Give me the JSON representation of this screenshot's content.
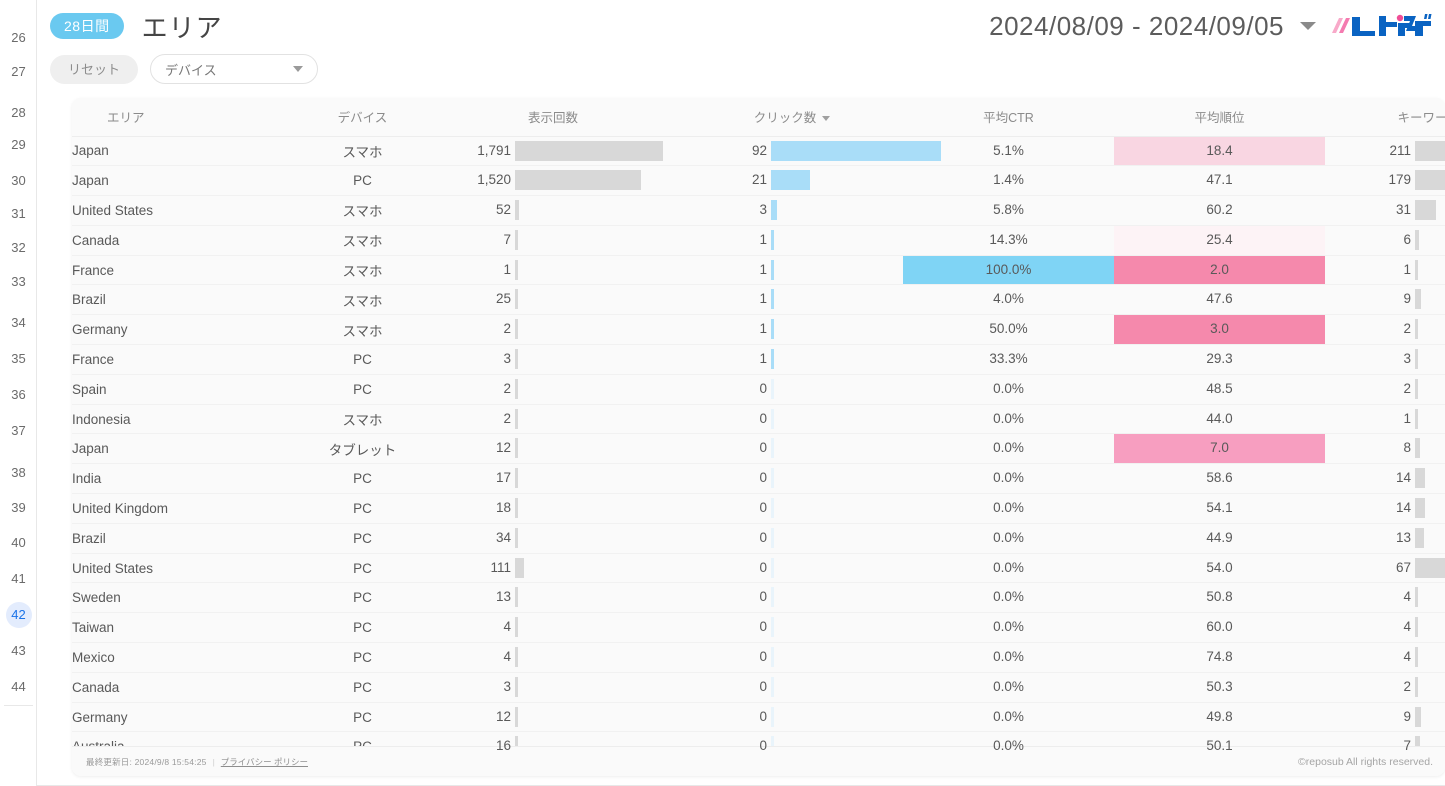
{
  "gutter": {
    "numbers": [
      26,
      27,
      28,
      29,
      30,
      31,
      32,
      33,
      34,
      35,
      36,
      37,
      38,
      39,
      40,
      41,
      42,
      43,
      44
    ],
    "active": 42
  },
  "header": {
    "period_badge": "28日間",
    "title": "エリア",
    "date_range": "2024/08/09 - 2024/09/05",
    "caret_icon": "chevron-down-icon",
    "logo_text": "レポサブ",
    "logo_colors": {
      "blue": "#0a63c2",
      "pink": "#f47bb0"
    }
  },
  "filters": {
    "reset_label": "リセット",
    "device_select": {
      "value": "デバイス",
      "caret_icon": "chevron-down-icon"
    }
  },
  "table": {
    "columns": [
      {
        "key": "area",
        "label": "エリア",
        "align": "left",
        "sorted": false
      },
      {
        "key": "device",
        "label": "デバイス",
        "align": "center",
        "sorted": false
      },
      {
        "key": "imp",
        "label": "表示回数",
        "align": "center",
        "sorted": false
      },
      {
        "key": "clicks",
        "label": "クリック数",
        "align": "center",
        "sorted": true
      },
      {
        "key": "ctr",
        "label": "平均CTR",
        "align": "center",
        "sorted": false
      },
      {
        "key": "pos",
        "label": "平均順位",
        "align": "center",
        "sorted": false
      },
      {
        "key": "kw",
        "label": "キーワード数",
        "align": "center",
        "sorted": false
      }
    ],
    "sort_caret_icon": "caret-down-icon",
    "rows": [
      {
        "area": "Japan",
        "device": "スマホ",
        "imp": "1,791",
        "imp_v": 1791,
        "clicks": "92",
        "clicks_v": 92,
        "ctr": "5.1%",
        "ctr_v": 5.1,
        "pos": "18.4",
        "pos_v": 18.4,
        "kw": "211",
        "kw_v": 211
      },
      {
        "area": "Japan",
        "device": "PC",
        "imp": "1,520",
        "imp_v": 1520,
        "clicks": "21",
        "clicks_v": 21,
        "ctr": "1.4%",
        "ctr_v": 1.4,
        "pos": "47.1",
        "pos_v": 47.1,
        "kw": "179",
        "kw_v": 179
      },
      {
        "area": "United States",
        "device": "スマホ",
        "imp": "52",
        "imp_v": 52,
        "clicks": "3",
        "clicks_v": 3,
        "ctr": "5.8%",
        "ctr_v": 5.8,
        "pos": "60.2",
        "pos_v": 60.2,
        "kw": "31",
        "kw_v": 31
      },
      {
        "area": "Canada",
        "device": "スマホ",
        "imp": "7",
        "imp_v": 7,
        "clicks": "1",
        "clicks_v": 1,
        "ctr": "14.3%",
        "ctr_v": 14.3,
        "pos": "25.4",
        "pos_v": 25.4,
        "kw": "6",
        "kw_v": 6
      },
      {
        "area": "France",
        "device": "スマホ",
        "imp": "1",
        "imp_v": 1,
        "clicks": "1",
        "clicks_v": 1,
        "ctr": "100.0%",
        "ctr_v": 100.0,
        "pos": "2.0",
        "pos_v": 2.0,
        "kw": "1",
        "kw_v": 1
      },
      {
        "area": "Brazil",
        "device": "スマホ",
        "imp": "25",
        "imp_v": 25,
        "clicks": "1",
        "clicks_v": 1,
        "ctr": "4.0%",
        "ctr_v": 4.0,
        "pos": "47.6",
        "pos_v": 47.6,
        "kw": "9",
        "kw_v": 9
      },
      {
        "area": "Germany",
        "device": "スマホ",
        "imp": "2",
        "imp_v": 2,
        "clicks": "1",
        "clicks_v": 1,
        "ctr": "50.0%",
        "ctr_v": 50.0,
        "pos": "3.0",
        "pos_v": 3.0,
        "kw": "2",
        "kw_v": 2
      },
      {
        "area": "France",
        "device": "PC",
        "imp": "3",
        "imp_v": 3,
        "clicks": "1",
        "clicks_v": 1,
        "ctr": "33.3%",
        "ctr_v": 33.3,
        "pos": "29.3",
        "pos_v": 29.3,
        "kw": "3",
        "kw_v": 3
      },
      {
        "area": "Spain",
        "device": "PC",
        "imp": "2",
        "imp_v": 2,
        "clicks": "0",
        "clicks_v": 0,
        "ctr": "0.0%",
        "ctr_v": 0.0,
        "pos": "48.5",
        "pos_v": 48.5,
        "kw": "2",
        "kw_v": 2
      },
      {
        "area": "Indonesia",
        "device": "スマホ",
        "imp": "2",
        "imp_v": 2,
        "clicks": "0",
        "clicks_v": 0,
        "ctr": "0.0%",
        "ctr_v": 0.0,
        "pos": "44.0",
        "pos_v": 44.0,
        "kw": "1",
        "kw_v": 1
      },
      {
        "area": "Japan",
        "device": "タブレット",
        "imp": "12",
        "imp_v": 12,
        "clicks": "0",
        "clicks_v": 0,
        "ctr": "0.0%",
        "ctr_v": 0.0,
        "pos": "7.0",
        "pos_v": 7.0,
        "kw": "8",
        "kw_v": 8
      },
      {
        "area": "India",
        "device": "PC",
        "imp": "17",
        "imp_v": 17,
        "clicks": "0",
        "clicks_v": 0,
        "ctr": "0.0%",
        "ctr_v": 0.0,
        "pos": "58.6",
        "pos_v": 58.6,
        "kw": "14",
        "kw_v": 14
      },
      {
        "area": "United Kingdom",
        "device": "PC",
        "imp": "18",
        "imp_v": 18,
        "clicks": "0",
        "clicks_v": 0,
        "ctr": "0.0%",
        "ctr_v": 0.0,
        "pos": "54.1",
        "pos_v": 54.1,
        "kw": "14",
        "kw_v": 14
      },
      {
        "area": "Brazil",
        "device": "PC",
        "imp": "34",
        "imp_v": 34,
        "clicks": "0",
        "clicks_v": 0,
        "ctr": "0.0%",
        "ctr_v": 0.0,
        "pos": "44.9",
        "pos_v": 44.9,
        "kw": "13",
        "kw_v": 13
      },
      {
        "area": "United States",
        "device": "PC",
        "imp": "111",
        "imp_v": 111,
        "clicks": "0",
        "clicks_v": 0,
        "ctr": "0.0%",
        "ctr_v": 0.0,
        "pos": "54.0",
        "pos_v": 54.0,
        "kw": "67",
        "kw_v": 67
      },
      {
        "area": "Sweden",
        "device": "PC",
        "imp": "13",
        "imp_v": 13,
        "clicks": "0",
        "clicks_v": 0,
        "ctr": "0.0%",
        "ctr_v": 0.0,
        "pos": "50.8",
        "pos_v": 50.8,
        "kw": "4",
        "kw_v": 4
      },
      {
        "area": "Taiwan",
        "device": "PC",
        "imp": "4",
        "imp_v": 4,
        "clicks": "0",
        "clicks_v": 0,
        "ctr": "0.0%",
        "ctr_v": 0.0,
        "pos": "60.0",
        "pos_v": 60.0,
        "kw": "4",
        "kw_v": 4
      },
      {
        "area": "Mexico",
        "device": "PC",
        "imp": "4",
        "imp_v": 4,
        "clicks": "0",
        "clicks_v": 0,
        "ctr": "0.0%",
        "ctr_v": 0.0,
        "pos": "74.8",
        "pos_v": 74.8,
        "kw": "4",
        "kw_v": 4
      },
      {
        "area": "Canada",
        "device": "PC",
        "imp": "3",
        "imp_v": 3,
        "clicks": "0",
        "clicks_v": 0,
        "ctr": "0.0%",
        "ctr_v": 0.0,
        "pos": "50.3",
        "pos_v": 50.3,
        "kw": "2",
        "kw_v": 2
      },
      {
        "area": "Germany",
        "device": "PC",
        "imp": "12",
        "imp_v": 12,
        "clicks": "0",
        "clicks_v": 0,
        "ctr": "0.0%",
        "ctr_v": 0.0,
        "pos": "49.8",
        "pos_v": 49.8,
        "kw": "9",
        "kw_v": 9
      },
      {
        "area": "Australia",
        "device": "PC",
        "imp": "16",
        "imp_v": 16,
        "clicks": "0",
        "clicks_v": 0,
        "ctr": "0.0%",
        "ctr_v": 0.0,
        "pos": "50.1",
        "pos_v": 50.1,
        "kw": "7",
        "kw_v": 7
      }
    ]
  },
  "scales": {
    "imp_max": 1791,
    "clicks_max": 92,
    "kw_max": 211,
    "bar_gray": "#d8d8d8",
    "bar_blue": "#a9ddf8",
    "ctr_heat": "#7fd4f5",
    "pos_heat": "#f589ac"
  },
  "footer": {
    "updated_label": "最終更新日: 2024/9/8 15:54:25",
    "separator": "|",
    "privacy_link": "プライバシー ポリシー",
    "copyright": "©reposub All rights reserved."
  }
}
